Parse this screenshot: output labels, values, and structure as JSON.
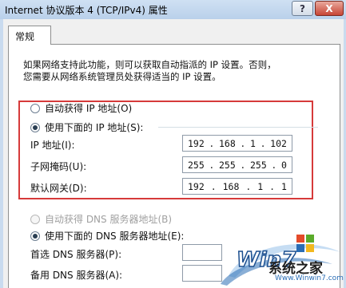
{
  "window": {
    "title": "Internet 协议版本 4 (TCP/IPv4) 属性",
    "help_label": "?",
    "close_label": "X"
  },
  "tabs": [
    {
      "label": "常规"
    }
  ],
  "intro": {
    "line1": "如果网络支持此功能，则可以获取自动指派的 IP 设置。否则，",
    "line2": "您需要从网络系统管理员处获得适当的 IP 设置。"
  },
  "ip_section": {
    "auto_option": "自动获得 IP 地址(O)",
    "manual_option": "使用下面的 IP 地址(S):",
    "selected": "manual",
    "fields": [
      {
        "label": "IP 地址(I):",
        "value": [
          "192",
          "168",
          "1",
          "102"
        ]
      },
      {
        "label": "子网掩码(U):",
        "value": [
          "255",
          "255",
          "255",
          "0"
        ]
      },
      {
        "label": "默认网关(D):",
        "value": [
          "192",
          "168",
          "1",
          "1"
        ]
      }
    ]
  },
  "dns_section": {
    "auto_option": "自动获得 DNS 服务器地址(B)",
    "manual_option": "使用下面的 DNS 服务器地址(E):",
    "selected": "manual",
    "fields": [
      {
        "label": "首选 DNS 服务器(P):",
        "value": ""
      },
      {
        "label": "备用 DNS 服务器(A):",
        "value": ""
      }
    ]
  },
  "watermark": {
    "logo_text": "Win7",
    "brand": "系统之家",
    "url": "Www.Winwin7.com"
  },
  "colors": {
    "highlight_border": "#d63a3a",
    "titlebar": "#c9dbef",
    "close_button": "#c74535"
  }
}
